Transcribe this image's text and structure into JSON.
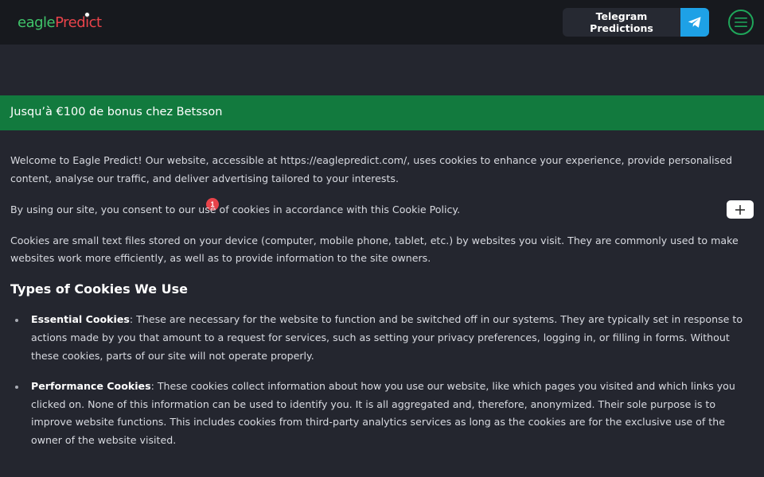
{
  "header": {
    "logo_eagle": "eagle",
    "logo_predict": "Predict",
    "telegram_label": "Telegram Predictions",
    "telegram_icon": "telegram-icon",
    "menu_icon": "hamburger-menu-icon"
  },
  "promo": {
    "text": "Jusqu’à €100 de bonus chez Betsson",
    "badge_count": "1",
    "expand_icon": "plus-icon"
  },
  "content": {
    "paragraphs": [
      "Welcome to Eagle Predict! Our website, accessible at https://eaglepredict.com/, uses cookies to enhance your experience, provide personalised content, analyse our traffic, and deliver advertising tailored to your interests.",
      "By using our site, you consent to our use of cookies in accordance with this Cookie Policy.",
      "Cookies are small text files stored on your device (computer, mobile phone, tablet, etc.) by websites you visit. They are commonly used to make websites work more efficiently, as well as to provide information to the site owners."
    ],
    "heading": "Types of Cookies We Use",
    "list": [
      {
        "term": "Essential Cookies",
        "desc": ": These are necessary for the website to function and be switched off in our systems. They are typically set in response to actions made by you that amount to a request for services, such as setting your privacy preferences, logging in, or filling in forms. Without these cookies, parts of our site will not operate properly."
      },
      {
        "term": "Performance Cookies",
        "desc": ": These cookies collect information about how you use our website, like which pages you visited and which links you clicked on. None of this information can be used to identify you. It is all aggregated and, therefore, anonymized. Their sole purpose is to improve website functions. This includes cookies from third-party analytics services as long as the cookies are for the exclusive use of the owner of the website visited."
      }
    ]
  },
  "colors": {
    "background": "#24262f",
    "header_bg": "#17191e",
    "promo_green": "#127a3e",
    "telegram_blue": "#1ea1e6",
    "badge_red": "#e8434a",
    "logo_green": "#3fc46a"
  }
}
